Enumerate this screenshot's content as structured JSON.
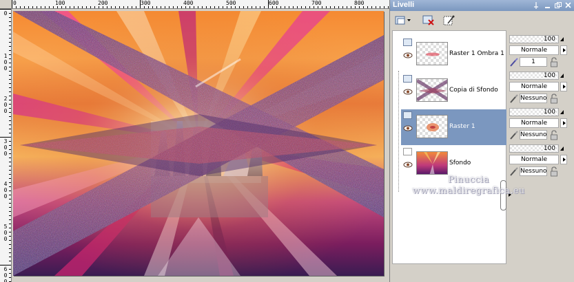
{
  "canvas": {
    "ruler_top_labels": [
      "0",
      "100",
      "200",
      "300",
      "400",
      "500",
      "600",
      "700",
      "800"
    ],
    "ruler_left_labels": [
      "0",
      "100",
      "200",
      "300",
      "400",
      "500",
      "600"
    ]
  },
  "panel": {
    "title": "Livelli",
    "title_buttons": [
      "pin-icon",
      "minimize-icon",
      "restore-icon",
      "close-icon"
    ],
    "toolbar": [
      "new-layer-icon",
      "delete-layer-icon",
      "layer-properties-icon"
    ]
  },
  "layers": [
    {
      "name": "Raster 1 Ombra 1",
      "opacity": "100",
      "blend_mode": "Normale",
      "group": "1",
      "selected": false
    },
    {
      "name": "Copia di Sfondo",
      "opacity": "100",
      "blend_mode": "Normale",
      "group": "Nessuno",
      "selected": false
    },
    {
      "name": "Raster 1",
      "opacity": "100",
      "blend_mode": "Normale",
      "group": "Nessuno",
      "selected": true
    },
    {
      "name": "Sfondo",
      "opacity": "100",
      "blend_mode": "Normale",
      "group": "Nessuno",
      "selected": false
    }
  ],
  "watermark": {
    "line1": "Pinuccia",
    "line2": "www.maldiregrafica.eu"
  },
  "colors": {
    "selection": "#7b97bf",
    "titlebar": "#8aa4c8",
    "panel_bg": "#d4d0c8"
  }
}
